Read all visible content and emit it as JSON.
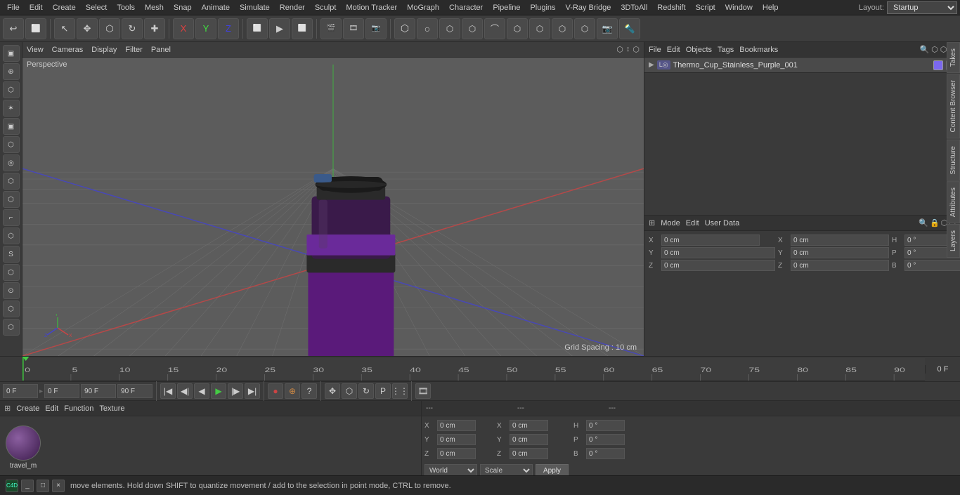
{
  "menubar": {
    "items": [
      "File",
      "Edit",
      "Create",
      "Select",
      "Tools",
      "Mesh",
      "Snap",
      "Animate",
      "Simulate",
      "Render",
      "Sculpt",
      "Motion Tracker",
      "MoGraph",
      "Character",
      "Pipeline",
      "Plugins",
      "V-Ray Bridge",
      "3DToAll",
      "Redshift",
      "Script",
      "Window",
      "Help"
    ],
    "layout_label": "Layout:",
    "layout_value": "Startup"
  },
  "toolbar": {
    "undo_label": "↩",
    "tools": [
      "↩",
      "⬜",
      "✥",
      "⬡",
      "↻",
      "✚",
      "X",
      "Y",
      "Z",
      "⬜",
      "▶",
      "⬜",
      "🎬",
      "🎞",
      "📷",
      "⬡",
      "⬡",
      "⬡",
      "⬡",
      "⬡",
      "⬡",
      "⬡",
      "⬡",
      "🔦"
    ]
  },
  "viewport": {
    "header_items": [
      "View",
      "Cameras",
      "Display",
      "Filter",
      "Panel"
    ],
    "label": "Perspective",
    "grid_spacing": "Grid Spacing : 10 cm"
  },
  "timeline": {
    "markers": [
      "0",
      "5",
      "10",
      "15",
      "20",
      "25",
      "30",
      "35",
      "40",
      "45",
      "50",
      "55",
      "60",
      "65",
      "70",
      "75",
      "80",
      "85",
      "90"
    ],
    "end_frame": "0 F",
    "current_frame": "0 F",
    "start_frame": "0 F",
    "end_val": "90 F",
    "end_val2": "90 F"
  },
  "right_panel": {
    "header_items": [
      "File",
      "Edit",
      "Objects",
      "Tags",
      "Bookmarks"
    ],
    "object_name": "Thermo_Cup_Stainless_Purple_001",
    "tabs": [
      "Takes",
      "Content Browser",
      "Structure",
      "Attributes",
      "Layers"
    ]
  },
  "attributes": {
    "header_items": [
      "Mode",
      "Edit",
      "User Data"
    ],
    "fields": {
      "x_pos": "0 cm",
      "y_pos": "0 cm",
      "z_pos": "0 cm",
      "x_rot": "0°",
      "y_rot": "0°",
      "z_rot": "0°",
      "h": "0°",
      "p": "0°",
      "b": "0°"
    }
  },
  "material": {
    "header_items": [
      "Create",
      "Edit",
      "Function",
      "Texture"
    ],
    "name": "travel_m"
  },
  "coordinates": {
    "x_pos": "0 cm",
    "y_pos": "0 cm",
    "z_pos": "0 cm",
    "x_rot": "0 cm",
    "y_rot": "0 cm",
    "z_rot": "0 cm",
    "h_val": "0°",
    "p_val": "0°",
    "b_val": "0°",
    "world_label": "World",
    "scale_label": "Scale",
    "apply_label": "Apply"
  },
  "status": {
    "text": "move elements. Hold down SHIFT to quantize movement / add to the selection in point mode, CTRL to remove."
  }
}
